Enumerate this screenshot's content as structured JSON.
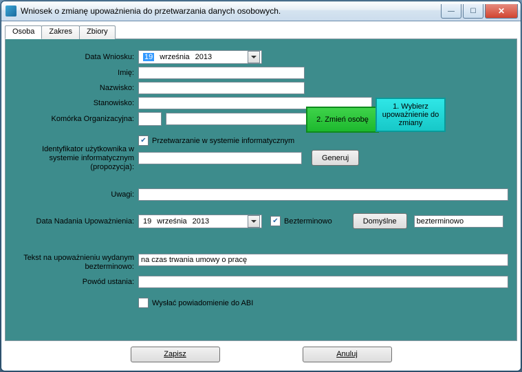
{
  "window": {
    "title": "Wniosek o zmianę upoważnienia do przetwarzania danych osobowych."
  },
  "tabs": {
    "t0": "Osoba",
    "t1": "Zakres",
    "t2": "Zbiory"
  },
  "labels": {
    "dataWniosku": "Data Wniosku:",
    "imie": "Imię:",
    "nazwisko": "Nazwisko:",
    "stanowisko": "Stanowisko:",
    "komorka": "Komórka Organizacyjna:",
    "identyfikator": "Identyfikator użytkownika w systemie informatycznym (propozycja):",
    "uwagi": "Uwagi:",
    "dataNadania": "Data Nadania Upoważnienia:",
    "tekst": "Tekst na upoważnieniu wydanym bezterminowo:",
    "powod": "Powód ustania:"
  },
  "checks": {
    "przetwarzanie": "Przetwarzanie w systemie informatycznym",
    "bezterminowo": "Bezterminowo",
    "wyslac": "Wysłać powiadomienie do ABI"
  },
  "dates": {
    "wniosek": {
      "d": "19",
      "m": "września",
      "y": "2013"
    },
    "nadanie": {
      "d": "19",
      "m": "września",
      "y": "2013"
    }
  },
  "buttons": {
    "zmien": "2. Zmień osobę",
    "wybierz": "1. Wybierz upoważnienie do zmiany",
    "generuj": "Generuj",
    "domyslne": "Domyślne",
    "zapisz": "Zapisz",
    "anuluj": "Anuluj"
  },
  "values": {
    "domyslneText": "bezterminowo",
    "tekstVal": "na czas trwania umowy o pracę"
  }
}
